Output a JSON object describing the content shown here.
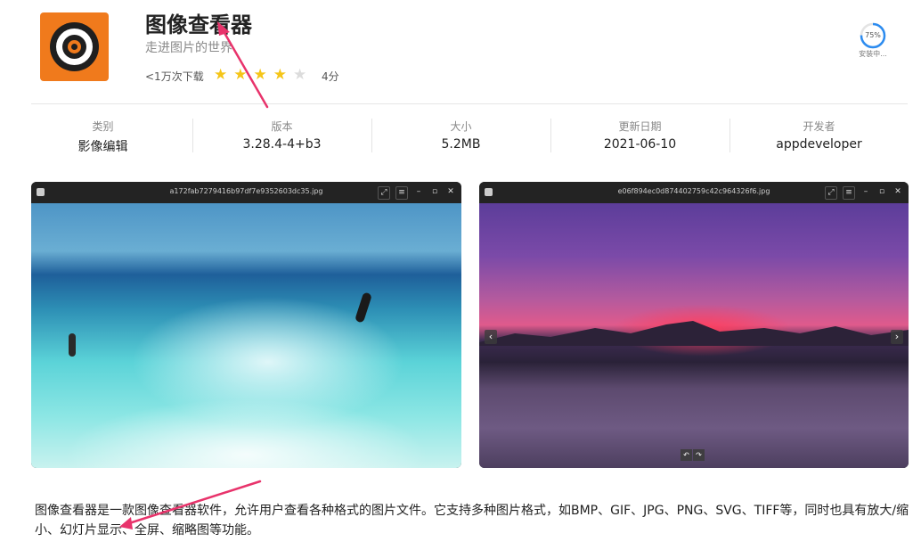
{
  "app": {
    "title": "图像查看器",
    "subtitle": "走进图片的世界",
    "downloads": "<1万次下载",
    "rating": {
      "value": 4,
      "max": 5,
      "score_text": "4分"
    },
    "install": {
      "progress_text": "75%",
      "progress": 0.75,
      "status": "安装中..."
    }
  },
  "info": [
    {
      "label": "类别",
      "value": "影像编辑"
    },
    {
      "label": "版本",
      "value": "3.28.4-4+b3"
    },
    {
      "label": "大小",
      "value": "5.2MB"
    },
    {
      "label": "更新日期",
      "value": "2021-06-10"
    },
    {
      "label": "开发者",
      "value": "appdeveloper"
    }
  ],
  "screenshots": [
    {
      "filename": "a172fab7279416b97df7e9352603dc35.jpg"
    },
    {
      "filename": "e06f894ec0d874402759c42c964326f6.jpg"
    }
  ],
  "description": "图像查看器是一款图像查看器软件，允许用户查看各种格式的图片文件。它支持多种图片格式，如BMP、GIF、JPG、PNG、SVG、TIFF等，同时也具有放大/缩小、幻灯片显示、全屏、缩略图等功能。",
  "colors": {
    "accent": "#2d8cf0",
    "star": "#f5c518",
    "annotation": "#e8336b"
  },
  "icons": {
    "window": [
      "window-app-icon",
      "fullscreen-icon",
      "menu-icon",
      "minimize-icon",
      "maximize-icon",
      "close-icon"
    ],
    "viewer": [
      "previous-arrow-icon",
      "next-arrow-icon",
      "rotate-left-icon",
      "rotate-right-icon"
    ]
  }
}
